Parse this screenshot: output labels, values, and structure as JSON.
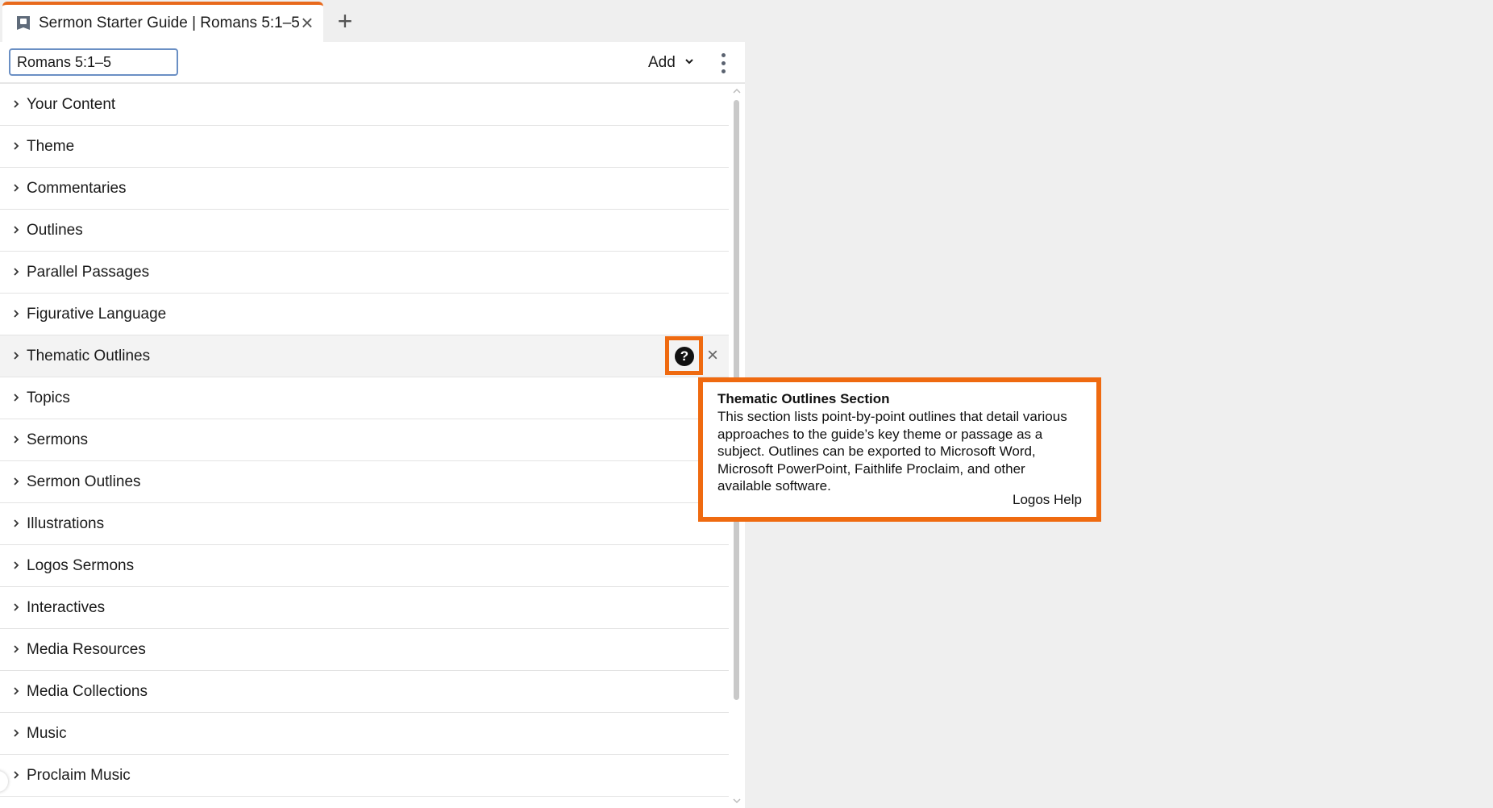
{
  "tab": {
    "title": "Sermon Starter Guide | Romans 5:1–5",
    "icon": "guide-icon",
    "accent_color": "#e8691c"
  },
  "toolbar": {
    "reference_value": "Romans 5:1–5",
    "add_label": "Add"
  },
  "sections": [
    "Your Content",
    "Theme",
    "Commentaries",
    "Outlines",
    "Parallel Passages",
    "Figurative Language",
    "Thematic Outlines",
    "Topics",
    "Sermons",
    "Sermon Outlines",
    "Illustrations",
    "Logos Sermons",
    "Interactives",
    "Media Resources",
    "Media Collections",
    "Music",
    "Proclaim Music"
  ],
  "hovered_section_index": 6,
  "tooltip": {
    "title": "Thematic Outlines Section",
    "body": "This section lists point-by-point outlines that detail various approaches to the guide’s key theme or passage as a subject. Outlines can be exported to Microsoft Word, Microsoft PowerPoint, Faithlife Proclaim, and other available software.",
    "link": "Logos Help",
    "highlight_color": "#ef6a10"
  },
  "icons": {
    "help": "?",
    "remove": "×",
    "new_tab": "+",
    "close_tab": "×"
  }
}
